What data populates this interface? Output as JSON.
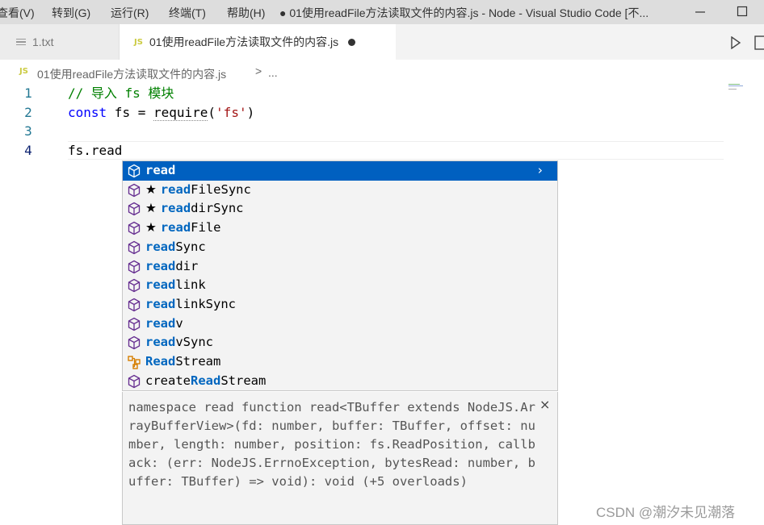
{
  "menu": {
    "items": [
      "查看(V)",
      "转到(G)",
      "运行(R)",
      "终端(T)",
      "帮助(H)"
    ],
    "window_title": "● 01使用readFile方法读取文件的内容.js - Node - Visual Studio Code [不..."
  },
  "tabs": [
    {
      "label": "1.txt",
      "icon": "lines-icon",
      "active": false
    },
    {
      "label": "01使用readFile方法读取文件的内容.js",
      "badge": "JS",
      "active": true,
      "dirty": true
    }
  ],
  "breadcrumb": {
    "badge": "JS",
    "file": "01使用readFile方法读取文件的内容.js",
    "separator": ">",
    "more": "..."
  },
  "editor": {
    "lines": [
      {
        "number": "1",
        "text": "// 导入 fs 模块"
      },
      {
        "number": "2",
        "keyword": "const",
        "middle": " fs = ",
        "func": "require",
        "open": "(",
        "string": "'fs'",
        "close": ")"
      },
      {
        "number": "3",
        "text": ""
      },
      {
        "number": "4",
        "text": "fs.read"
      }
    ]
  },
  "suggest": {
    "items": [
      {
        "match": "read",
        "rest": "",
        "star": false,
        "icon": "method-cube-icon",
        "selected": true
      },
      {
        "match": "read",
        "rest": "FileSync",
        "star": true,
        "icon": "method-cube-icon",
        "selected": false
      },
      {
        "match": "read",
        "rest": "dirSync",
        "star": true,
        "icon": "method-cube-icon",
        "selected": false
      },
      {
        "match": "read",
        "rest": "File",
        "star": true,
        "icon": "method-cube-icon",
        "selected": false
      },
      {
        "match": "read",
        "rest": "Sync",
        "star": false,
        "icon": "method-cube-icon",
        "selected": false
      },
      {
        "match": "read",
        "rest": "dir",
        "star": false,
        "icon": "method-cube-icon",
        "selected": false
      },
      {
        "match": "read",
        "rest": "link",
        "star": false,
        "icon": "method-cube-icon",
        "selected": false
      },
      {
        "match": "read",
        "rest": "linkSync",
        "star": false,
        "icon": "method-cube-icon",
        "selected": false
      },
      {
        "match": "read",
        "rest": "v",
        "star": false,
        "icon": "method-cube-icon",
        "selected": false
      },
      {
        "match": "read",
        "rest": "vSync",
        "star": false,
        "icon": "method-cube-icon",
        "selected": false
      },
      {
        "prefix": "",
        "match": "Read",
        "rest": "Stream",
        "star": false,
        "icon": "class-icon",
        "selected": false
      },
      {
        "prefix": "create",
        "match": "Read",
        "rest": "Stream",
        "star": false,
        "icon": "method-cube-icon",
        "selected": false
      }
    ],
    "star_glyph": "★",
    "chevron": "›"
  },
  "details": {
    "text": "namespace read function read<TBuffer extends NodeJS.ArrayBufferView>(fd: number, buffer: TBuffer, offset: number, length: number, position: fs.ReadPosition, callback: (err: NodeJS.ErrnoException, bytesRead: number, buffer: TBuffer) => void): void (+5 overloads)",
    "close": "×"
  },
  "watermark": "CSDN @潮汐未见潮落",
  "colors": {
    "accent": "#0060c0",
    "match_highlight": "#0066bf",
    "method_icon": "#652d90",
    "class_icon": "#d67e00",
    "js_badge": "#cbcb41"
  }
}
